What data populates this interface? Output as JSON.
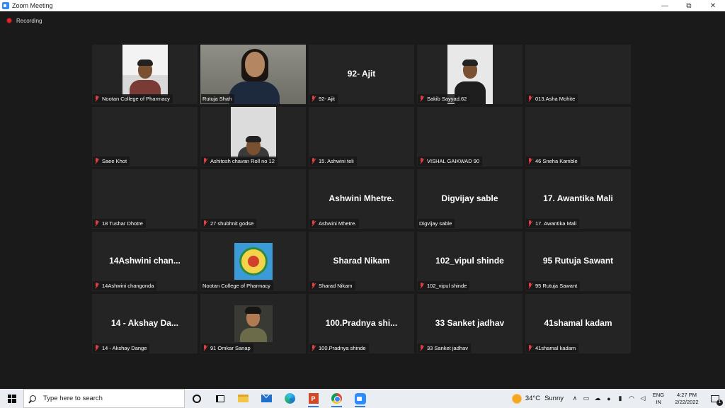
{
  "window": {
    "title": "Zoom Meeting",
    "minimize_glyph": "—",
    "restore_glyph": "⧉",
    "close_glyph": "✕"
  },
  "recording": {
    "label": "Recording",
    "color": "#e02828"
  },
  "accent": {
    "active_speaker_border": "#c8e64a",
    "zoom_blue": "#2d8cff"
  },
  "gallery": [
    {
      "big": "",
      "label": "Nootan College of Pharmacy",
      "muted": true,
      "video": "person"
    },
    {
      "big": "",
      "label": "Rutuja Shah",
      "muted": false,
      "video": "active-speaker"
    },
    {
      "big": "92- Ajit",
      "label": "92- Ajit",
      "muted": true,
      "video": "none"
    },
    {
      "big": "",
      "label": "Sakib Sayyad.62",
      "muted": true,
      "video": "person"
    },
    {
      "big": "",
      "label": "013.Asha Mohite",
      "muted": true,
      "video": "none"
    },
    {
      "big": "",
      "label": "Saee Khot",
      "muted": true,
      "video": "none"
    },
    {
      "big": "",
      "label": "Ashitosh chavan Roll no 12",
      "muted": true,
      "video": "person"
    },
    {
      "big": "",
      "label": "15. Ashwini teli",
      "muted": true,
      "video": "none"
    },
    {
      "big": "",
      "label": "VISHAL GAIKWAD 90",
      "muted": true,
      "video": "none"
    },
    {
      "big": "",
      "label": "46 Sneha Kamble",
      "muted": true,
      "video": "none"
    },
    {
      "big": "",
      "label": "18 Tushar Dhotre",
      "muted": true,
      "video": "none"
    },
    {
      "big": "",
      "label": "27 shubhnit godse",
      "muted": true,
      "video": "none"
    },
    {
      "big": "Ashwini Mhetre.",
      "label": "Ashwini Mhetre.",
      "muted": true,
      "video": "none"
    },
    {
      "big": "Digvijay sable",
      "label": "Digvijay sable",
      "muted": false,
      "video": "none"
    },
    {
      "big": "17. Awantika Mali",
      "label": "17. Awantika Mali",
      "muted": true,
      "video": "none"
    },
    {
      "big": "14Ashwini  chan...",
      "label": "14Ashwini changonda",
      "muted": true,
      "video": "none"
    },
    {
      "big": "",
      "label": "Nootan College of Pharmacy",
      "muted": false,
      "video": "logo"
    },
    {
      "big": "Sharad Nikam",
      "label": "Sharad Nikam",
      "muted": true,
      "video": "none"
    },
    {
      "big": "102_vipul shinde",
      "label": "102_vipul shinde",
      "muted": true,
      "video": "none"
    },
    {
      "big": "95 Rutuja Sawant",
      "label": "95 Rutuja Sawant",
      "muted": true,
      "video": "none"
    },
    {
      "big": "14 - Akshay Da...",
      "label": "14 - Akshay Dange",
      "muted": true,
      "video": "none"
    },
    {
      "big": "",
      "label": "91 Omkar Sanap",
      "muted": true,
      "video": "person"
    },
    {
      "big": "100.Pradnya  shi...",
      "label": "100.Pradnya shinde",
      "muted": true,
      "video": "none"
    },
    {
      "big": "33 Sanket jadhav",
      "label": "33 Sanket jadhav",
      "muted": true,
      "video": "none"
    },
    {
      "big": "41shamal kadam",
      "label": "41shamal kadam",
      "muted": true,
      "video": "none"
    }
  ],
  "taskbar": {
    "search_placeholder": "Type here to search",
    "apps": [
      "cortana-icon",
      "task-view-icon",
      "file-explorer-icon",
      "mail-icon",
      "edge-icon",
      "powerpoint-icon",
      "chrome-icon",
      "zoom-icon"
    ],
    "ppt_letter": "P",
    "weather_temp": "34°C",
    "weather_condition": "Sunny",
    "tray_chevron": "∧",
    "language_line1": "ENG",
    "language_line2": "IN",
    "time": "4:27 PM",
    "date": "2/22/2022",
    "notification_count": "1"
  }
}
